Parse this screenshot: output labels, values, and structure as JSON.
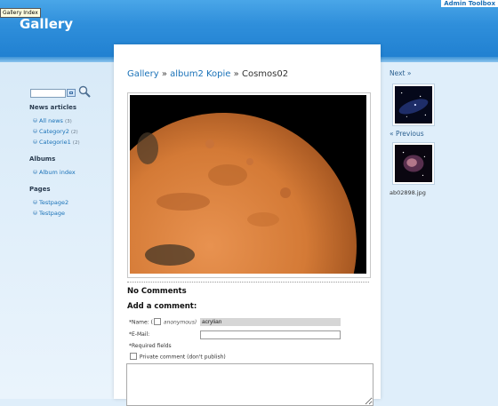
{
  "tooltip": "Gallery Index",
  "toolbar": {
    "admin_label": "Admin Toolbox"
  },
  "header": {
    "title": "Gallery"
  },
  "search": {
    "value": ""
  },
  "sidebar": {
    "sections": [
      {
        "heading": "News articles",
        "items": [
          {
            "label": "All news",
            "count": "(3)"
          },
          {
            "label": "Category2",
            "count": "(2)"
          },
          {
            "label": "Categorie1",
            "count": "(2)"
          }
        ]
      },
      {
        "heading": "Albums",
        "items": [
          {
            "label": "Album index",
            "count": ""
          }
        ]
      },
      {
        "heading": "Pages",
        "items": [
          {
            "label": "Testpage2",
            "count": ""
          },
          {
            "label": "Testpage",
            "count": ""
          }
        ]
      }
    ]
  },
  "breadcrumb": {
    "gallery": "Gallery",
    "sep": "»",
    "album": "album2 Kopie",
    "current": "Cosmos02"
  },
  "comments": {
    "none_text": "No Comments",
    "add_heading": "Add a comment:",
    "name_label": "*Name: (",
    "anon_label": "anonymous)",
    "name_value": "acrylian",
    "email_label": "*E-Mail:",
    "required_note": "*Required fields",
    "private_label": "Private comment (don't publish)"
  },
  "nav": {
    "next_label": "Next »",
    "prev_label": "« Previous",
    "prev_caption": "ab02898.jpg"
  },
  "colors": {
    "header_blue": "#2f8fdb",
    "link_blue": "#1a72b8",
    "mars_orange": "#d9823f"
  }
}
